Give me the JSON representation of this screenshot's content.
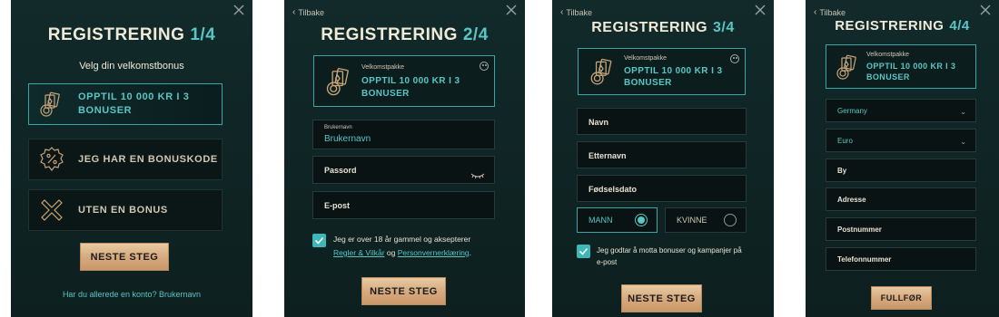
{
  "step1": {
    "title": "REGISTRERING",
    "step": "1/4",
    "subtitle": "Velg din velkomstbonus",
    "options": [
      {
        "label": "OPPTIL 10 000 KR I 3 BONUSER",
        "icon": "chip-cards-icon",
        "selected": true
      },
      {
        "label": "JEG HAR EN BONUSKODE",
        "icon": "percent-badge-icon",
        "selected": false
      },
      {
        "label": "UTEN EN BONUS",
        "icon": "x-mark-icon",
        "selected": false
      }
    ],
    "next_button": "NESTE STEG",
    "login_prompt": "Har du allerede en konto? Brukernavn"
  },
  "step2": {
    "back": "Tilbake",
    "title": "REGISTRERING",
    "step": "2/4",
    "package_label": "Velkomstpakke",
    "package_text_line1": "OPPTIL 10 000 KR I 3",
    "package_text_line2": "BONUSER",
    "username_label": "Brukernavn",
    "username_value": "Brukernavn",
    "password_label": "Passord",
    "email_label": "E-post",
    "consent_text": "Jeg er over 18 år gammel og aksepterer",
    "terms_link": "Regler & Vilkår",
    "and_text": "og",
    "privacy_link": "Personvernerklæring",
    "period": ".",
    "next_button": "NESTE STEG"
  },
  "step3": {
    "back": "Tilbake",
    "title": "REGISTRERING",
    "step": "3/4",
    "package_label": "Velkomstpakke",
    "package_text_line1": "OPPTIL 10 000 KR I 3",
    "package_text_line2": "BONUSER",
    "first_name": "Navn",
    "last_name": "Etternavn",
    "birthdate": "Fødselsdato",
    "gender_male": "MANN",
    "gender_female": "KVINNE",
    "marketing_consent": "Jeg godtar å motta bonuser og kampanjer på e-post",
    "next_button": "NESTE STEG"
  },
  "step4": {
    "back": "Tilbake",
    "title": "REGISTRERING",
    "step": "4/4",
    "package_label": "Velkomstpakke",
    "package_text_line1": "OPPTIL 10 000 KR I 3",
    "package_text_line2": "BONUSER",
    "country": "Germany",
    "currency": "Euro",
    "city": "By",
    "address": "Adresse",
    "postcode": "Postnummer",
    "phone": "Telefonnummer",
    "finish_button": "FULLFØR"
  },
  "colors": {
    "panel_bg": "#0f2323",
    "accent_teal": "#58c6c4",
    "button_gold": "#d7ab7e",
    "text_light": "#f0ead8"
  }
}
